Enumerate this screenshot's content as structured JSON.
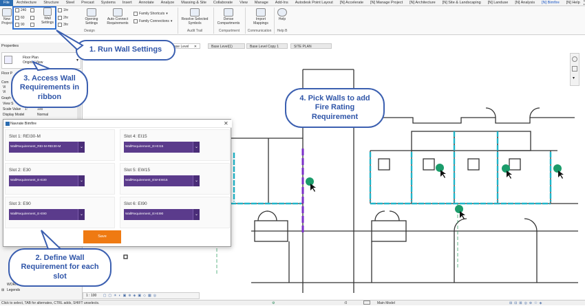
{
  "menubar": {
    "items": [
      "File",
      "Architecture",
      "Structure",
      "Steel",
      "Precast",
      "Systems",
      "Insert",
      "Annotate",
      "Analyze",
      "Massing & Site",
      "Collaborate",
      "View",
      "Manage",
      "Add-Ins",
      "Autodesk Point Layout",
      "[N] Accelerate",
      "[N] Manage Project",
      "[N] Architecture",
      "[N] Site & Landscaping",
      "[N] Landuse",
      "[N] Analysis",
      "[N] Bimfire",
      "[N] Help"
    ],
    "active": "[N] Bimfire",
    "right": "⊡ •"
  },
  "ribbon": {
    "new_label": "New\nProject",
    "wall_sizes": [
      "240",
      "60",
      "90"
    ],
    "hr_labels": [
      "1hr",
      "2hr",
      "3hr"
    ],
    "wall_settings": "Wall\nSettings",
    "opening_settings": "Opening\nSettings",
    "auto_connect": "Auto Connect\nRequirements",
    "family_shortcuts": "Family Shortcuts",
    "family_connections": "Family Connections",
    "resolve_symbols": "Resolve Selected\nSymbols",
    "dense_compartments": "Dense\nCompartments",
    "import_mappings": "Import\nMappings",
    "help": "Help",
    "groups": [
      "Design",
      "Audit Trail",
      "Compartment",
      "Communication",
      "Help B"
    ]
  },
  "properties": {
    "title": "Properties",
    "type_label": "Floor Plan",
    "type_sub": "Original View",
    "floor_label": "Floor P",
    "rows": [
      [
        "Scale Value",
        "1:",
        "100"
      ],
      [
        "Display Model",
        "",
        "Normal"
      ]
    ],
    "prefixes": [
      "Com",
      "Vi",
      "Vi",
      "Graph",
      "View S"
    ]
  },
  "tabs": [
    "ase Level",
    "Base Level(1)",
    "Base Level Copy 1",
    "SITE PLAN"
  ],
  "dialog": {
    "title": "Navrate Bimfire",
    "slots": [
      {
        "label": "Slot 1: REI30-M",
        "value": "WallRequirement_REI-M-REI30-M"
      },
      {
        "label": "Slot 4: EI15",
        "value": "WallRequirement_EI-EI15"
      },
      {
        "label": "Slot 2: E30",
        "value": "WallRequirement_E-E30"
      },
      {
        "label": "Slot 5: EW15",
        "value": "WallRequirement_EW-EW15"
      },
      {
        "label": "Slot 3: E90",
        "value": "WallRequirement_E-E90"
      },
      {
        "label": "Slot 6: EI90",
        "value": "WallRequirement_EI-EI90"
      }
    ],
    "save": "Save",
    "close": "✕"
  },
  "callouts": {
    "c1": "1. Run Wall Settings",
    "c2": "2. Define Wall Requirement for each slot",
    "c3": "3. Access Wall Requirements in ribbon",
    "c4": "4. Pick Walls to add Fire Rating Requirement"
  },
  "tree": [
    "WORK Views",
    "Legends"
  ],
  "view_scale": "1 : 100",
  "status": {
    "left": "Click to select, TAB for alternates, CTRL adds, SHIFT unselects.",
    "model": "Main Model",
    "zero": ":0"
  },
  "colors": {
    "accent": "#2b6cb0",
    "wall_fire": "#1fb5c9",
    "wall_special": "#7a2ec9",
    "marker": "#1b9c6b",
    "dropdown": "#5b3b8c",
    "save": "#ef7a12",
    "callout": "#3b5fb0"
  }
}
